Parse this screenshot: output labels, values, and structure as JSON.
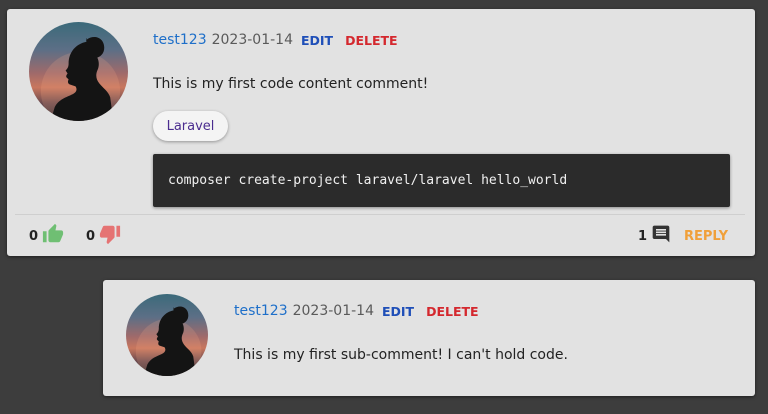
{
  "comment": {
    "username": "test123",
    "date": "2023-01-14",
    "edit_label": "EDIT",
    "delete_label": "DELETE",
    "text": "This is my first code content comment!",
    "tag": "Laravel",
    "code": "composer create-project laravel/laravel hello_world",
    "likes": "0",
    "dislikes": "0",
    "reply_count": "1",
    "reply_label": "REPLY",
    "colors": {
      "username": "#1e6fc9",
      "edit": "#1f4fb8",
      "delete": "#d4282e",
      "like": "#6fbf73",
      "dislike": "#e57373",
      "reply": "#f0a03a"
    },
    "icons": {
      "like": "thumb-up-icon",
      "dislike": "thumb-down-icon",
      "comments": "comment-icon"
    }
  },
  "sub_comment": {
    "username": "test123",
    "date": "2023-01-14",
    "edit_label": "EDIT",
    "delete_label": "DELETE",
    "text": "This is my first sub-comment! I can't hold code."
  }
}
